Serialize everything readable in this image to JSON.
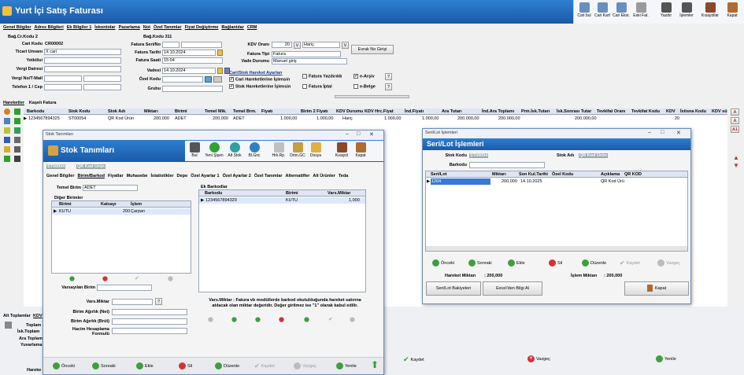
{
  "app": {
    "title": "Yurt İçi Satış Faturası"
  },
  "toolbar": {
    "items": [
      "Cari bul",
      "Cari Kart",
      "Cari Ekst.",
      "Eski Fat.",
      "Yazdır",
      "İşlemler",
      "Kısayollar",
      "Kapat"
    ]
  },
  "main_tabs": [
    "Genel Bilgiler",
    "Adres Bilgileri",
    "Ek Bilgiler 1",
    "İskontolar",
    "Pazarlama",
    "Not",
    "Özel Tanımlar",
    "Fiyat Değiştirme",
    "Bağlantılar",
    "CRM"
  ],
  "form": {
    "labels": {
      "bag_cr": "Bağ.Cr.Kodu 2",
      "cari_kodu": "Cari Kodu",
      "ticari": "Ticari Unvanı",
      "yetkili": "Yetkilisi",
      "vergi_dairesi": "Vergi Dairesi",
      "vergi_no": "Vergi No/T-Mail",
      "telefon": "Telefon 1 / Cep",
      "bag_kodu": "Bağ.Kodu 311",
      "seri_no": "Fatura Seri/No",
      "fatura_tarihi": "Fatura Tarihi",
      "fatura_saati": "Fatura Saati",
      "vadesi": "Vadesi",
      "ozel_kodu": "Özel Kodu",
      "grubu": "Grubu",
      "kdv_orani": "KDV Oranı",
      "fatura_tipi": "Fatura Tipi",
      "vade_durumu": "Vade Durumu"
    },
    "values": {
      "cari_kodu": "CR00002",
      "ticari": "X cari",
      "fatura_tarihi": "14.10.2024",
      "fatura_saati": "15:04",
      "vadesi": "14.10.2024",
      "kdv": "20",
      "kdv_v": "V",
      "haric": "Hariç",
      "fatura_tipi": "Fatura",
      "vade_durumu": "Manuel giriş"
    },
    "evrak_btn": "Evrak No Girişi",
    "cari_stok_title": "Cari/Stok Hareket Ayarları",
    "checks": [
      "Cari Hareketlerine İşlensin",
      "Stok Hareketlerine İşlensin",
      "Fatura Yazdırıldı",
      "Fatura İptal",
      "e-Arşiv",
      "e-Belge"
    ]
  },
  "hareket_tabs": [
    "Hareketler",
    "Kaşelı Fatura"
  ],
  "grid": {
    "headers": [
      "Barkodu",
      "Stok Kodu",
      "Stok Adı",
      "Miktarı",
      "Birimi",
      "Temel Mik.",
      "Temel Brm.",
      "Fiyatı",
      "Birim 2 Fiyatı",
      "KDV Durumu",
      "KDV Hrc.Fiyat",
      "İnd.Fiyatı",
      "Ara Tutarı",
      "İnd.Ara Toplamı",
      "Prm.İsk.Tutarı",
      "İsk.Sonrası Tutar",
      "Tevkifat Oranı",
      "Tevkifat Kodu",
      "KDV",
      "İstisna Kodu",
      "KDV sü"
    ],
    "row": [
      "1234567894325",
      "ST00054",
      "QR Kod Ürün",
      "200,000",
      "ADET",
      "200,000",
      "ADET",
      "1.000,00",
      "1.000,00",
      "Hariç",
      "1.000,00",
      "1.000,00",
      "200.000,00",
      "200.000,00",
      "",
      "200.000,00",
      "",
      "",
      "20",
      "",
      ""
    ]
  },
  "bottom": {
    "alt_toplamlar": "Alt Toplamlar",
    "kdv_tab": "KDV",
    "toplam": "Toplam",
    "isk_toplam": "İsk.Toplam",
    "ara_toplam": "Ara Toplam",
    "yuvarlama": "Yuvarlama",
    "hareket": "Hareke",
    "kaydet": "Kaydet",
    "vazgec": "Vazgeç",
    "yenile": "Yenile"
  },
  "stok": {
    "wtitle": "Stok Tanımları",
    "title": "Stok Tanımları",
    "toolbar": [
      "Bul",
      "Yeni Şişen",
      "Alt Stok",
      "Bl.Gnc",
      "Hrk.Rp.",
      "Dmn.GC",
      "Dosya",
      "Kısayol",
      "Kapat"
    ],
    "code": "ST00054",
    "name": "QR Kod Ürün",
    "tabs": [
      "Genel Bilgiler",
      "Birim/Barkod",
      "Fiyatlar",
      "Muhasebe",
      "İstatistikler",
      "Depo",
      "Özel Ayarlar 1",
      "Özel Ayarlar 2",
      "Özel Tanımlar",
      "Alternatifler",
      "Alt Ürünler",
      "Teda"
    ],
    "temel_birim_lbl": "Temel Birim",
    "temel_birim": "ADET",
    "diger_birimler": "Diğer Birimler",
    "db_headers": [
      "Birimi",
      "Katsayı",
      "İşlem"
    ],
    "db_row": [
      "KUTU",
      "200",
      "Çarpan"
    ],
    "varsayilan_birim": "Varsayılan Birim",
    "ek_barkodlar": "Ek Barkodlar",
    "eb_headers": [
      "Barkodu",
      "Birimi",
      "Vars.Miktar"
    ],
    "eb_row": [
      "1234567894329",
      "KUTU",
      "1,000"
    ],
    "vars_miktar": "Vars.Miktar",
    "birim_agirlik_net": "Birim Ağırlık (Net)",
    "birim_agirlik_brut": "Birim Ağırlık (Brüt)",
    "hacim": "Hacim Hesaplama Formulü",
    "note_b": "Vars.Miktar :",
    "note": " Fatura vb modüllerde barkod okutulduğunda hareket satırına atılacak olan miktar değeridir. Değer girilmez ise \"1\" olarak kabul edilir.",
    "nav": [
      "Önceki",
      "Sonraki",
      "Ekle",
      "Sil",
      "Düzenle",
      "Kaydet",
      "Vazgeç",
      "Yenile"
    ]
  },
  "seri": {
    "wtitle": "Seri/Lot İşlemleri",
    "title": "Seri/Lot İşlemleri",
    "stok_kodu_lbl": "Stok Kodu",
    "stok_kodu": "ST00054",
    "stok_adi_lbl": "Stok Adı",
    "stok_adi": "QR Kod Ürün",
    "barkodu_lbl": "Barkodu",
    "headers": [
      "Seri/Lot",
      "Miktarı",
      "Son Kul.Tarihi",
      "Özel Kodu",
      "Açıklama",
      "QR KOD"
    ],
    "row": [
      "1204",
      "200,000",
      "14.10.2025",
      "",
      "QR Kod Ürü",
      ""
    ],
    "nav": [
      "Önceki",
      "Sonraki",
      "Ekle",
      "Sil",
      "Düzenle",
      "Kaydet",
      "Vazgeç"
    ],
    "hareket_lbl": "Hareket Miktarı",
    "hareket": "200,000",
    "islem_lbl": "İşlem Miktarı",
    "islem": "200,000",
    "btns": [
      "Seri/Lot Bakiyeleri",
      "Excel'den Bilgi Al",
      "Kapat"
    ]
  }
}
